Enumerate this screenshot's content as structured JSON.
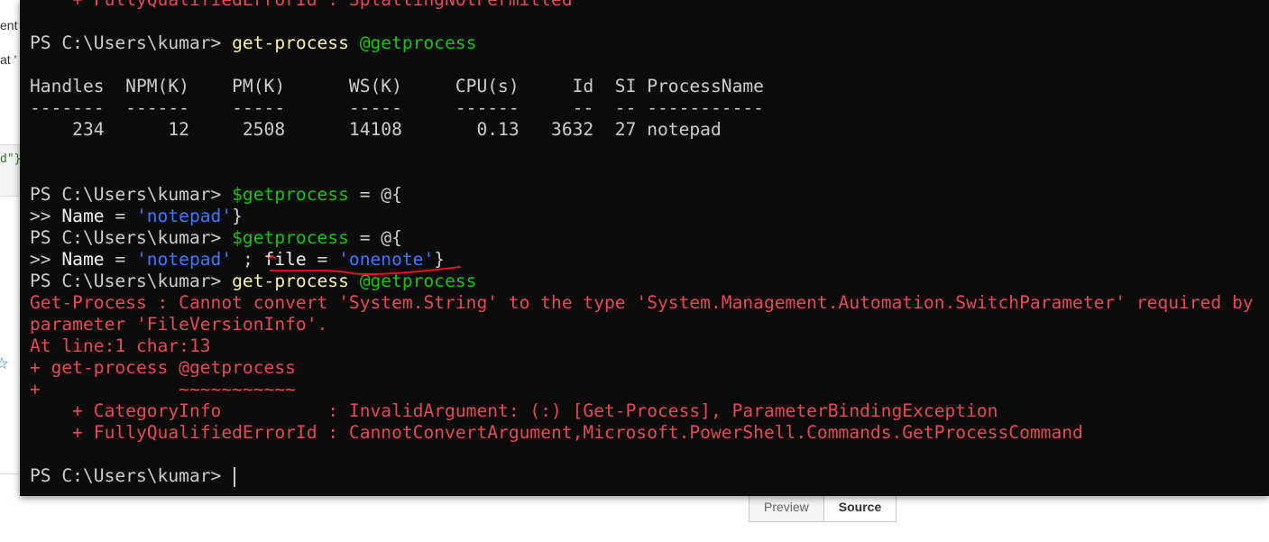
{
  "background": {
    "fragments": [
      "ent",
      "at '",
      "d\"}"
    ],
    "star_icon": "star-icon",
    "tabs": [
      {
        "label": "Preview",
        "active": false
      },
      {
        "label": "Source",
        "active": true
      }
    ]
  },
  "terminal": {
    "prompt": "PS C:\\Users\\kumar>",
    "continuation": ">>",
    "top_error_line": "    + FullyQualifiedErrorId : SplattingNotPermitted",
    "cmd1": {
      "name": "get-process",
      "arg": "@getprocess"
    },
    "table": {
      "header": "Handles  NPM(K)    PM(K)      WS(K)     CPU(s)     Id  SI ProcessName",
      "separator": "-------  ------    -----      -----     ------     --  -- -----------",
      "row": "    234      12     2508      14108       0.13   3632  27 notepad"
    },
    "assign1": {
      "var": "$getprocess",
      "op": "=",
      "open": "@{"
    },
    "cont1": {
      "key": "Name",
      "op": "=",
      "value": "'notepad'",
      "close": "}"
    },
    "assign2": {
      "var": "$getprocess",
      "op": "=",
      "open": "@{"
    },
    "cont2": {
      "key": "Name",
      "op": "=",
      "value": "'notepad'",
      "sep": ";",
      "key2": "file",
      "op2": "=",
      "value2": "'onenote'",
      "close": "}"
    },
    "cmd2": {
      "name": "get-process",
      "arg": "@getprocess"
    },
    "errors": [
      "Get-Process : Cannot convert 'System.String' to the type 'System.Management.Automation.SwitchParameter' required by",
      "parameter 'FileVersionInfo'.",
      "At line:1 char:13",
      "+ get-process @getprocess",
      "+             ~~~~~~~~~~~",
      "    + CategoryInfo          : InvalidArgument: (:) [Get-Process], ParameterBindingException",
      "    + FullyQualifiedErrorId : CannotConvertArgument,Microsoft.PowerShell.Commands.GetProcessCommand"
    ],
    "colors": {
      "background": "#0c0c0c",
      "text": "#cccccc",
      "command": "#f9f1a5",
      "variable": "#16c60c",
      "string": "#3b78ff",
      "error": "#e74856",
      "annotation": "#e81123"
    }
  }
}
